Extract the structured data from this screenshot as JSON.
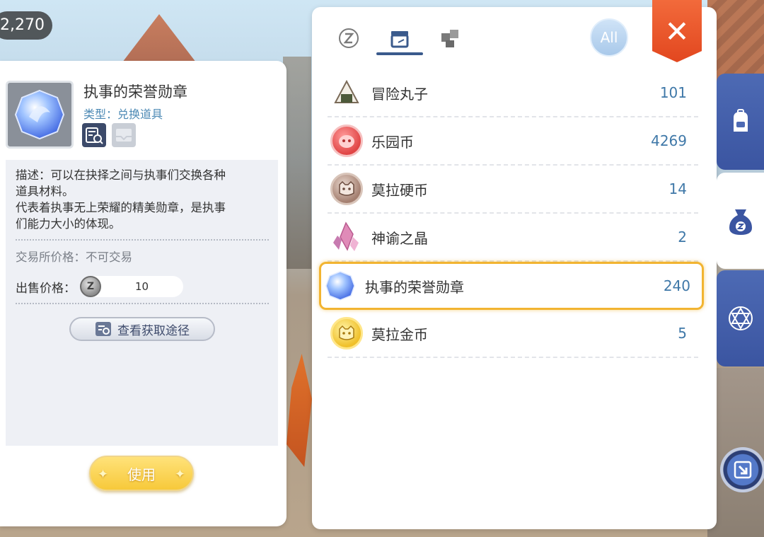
{
  "top_currency": {
    "amount": "2,270"
  },
  "detail": {
    "name": "执事的荣誉勋章",
    "type_label": "类型：兑换道具",
    "description_lines": [
      "描述：可以在抉择之间与执事们交换各种",
      "道具材料。",
      "代表着执事无上荣耀的精美勋章，是执事",
      "们能力大小的体现。"
    ],
    "trade_price": "交易所价格：不可交易",
    "sell_label": "出售价格：",
    "sell_value": "10",
    "source_button": "查看获取途径",
    "use_button": "使用"
  },
  "inventory": {
    "all_label": "All",
    "close_label": "✕",
    "items": [
      {
        "name": "冒险丸子",
        "count": "101",
        "icon": "rice-ball-icon"
      },
      {
        "name": "乐园币",
        "count": "4269",
        "icon": "park-coin-icon"
      },
      {
        "name": "莫拉硬币",
        "count": "14",
        "icon": "mora-coin-icon"
      },
      {
        "name": "神谕之晶",
        "count": "2",
        "icon": "oracle-crystal-icon"
      },
      {
        "name": "执事的荣誉勋章",
        "count": "240",
        "icon": "butler-medal-icon",
        "selected": true
      },
      {
        "name": "莫拉金币",
        "count": "5",
        "icon": "mora-gold-coin-icon"
      }
    ]
  },
  "colors": {
    "count_blue": "#3f78a8",
    "selected_border": "#f2b431",
    "close_red": "#e2471f",
    "side_tab_blue": "#4d6ab4"
  }
}
